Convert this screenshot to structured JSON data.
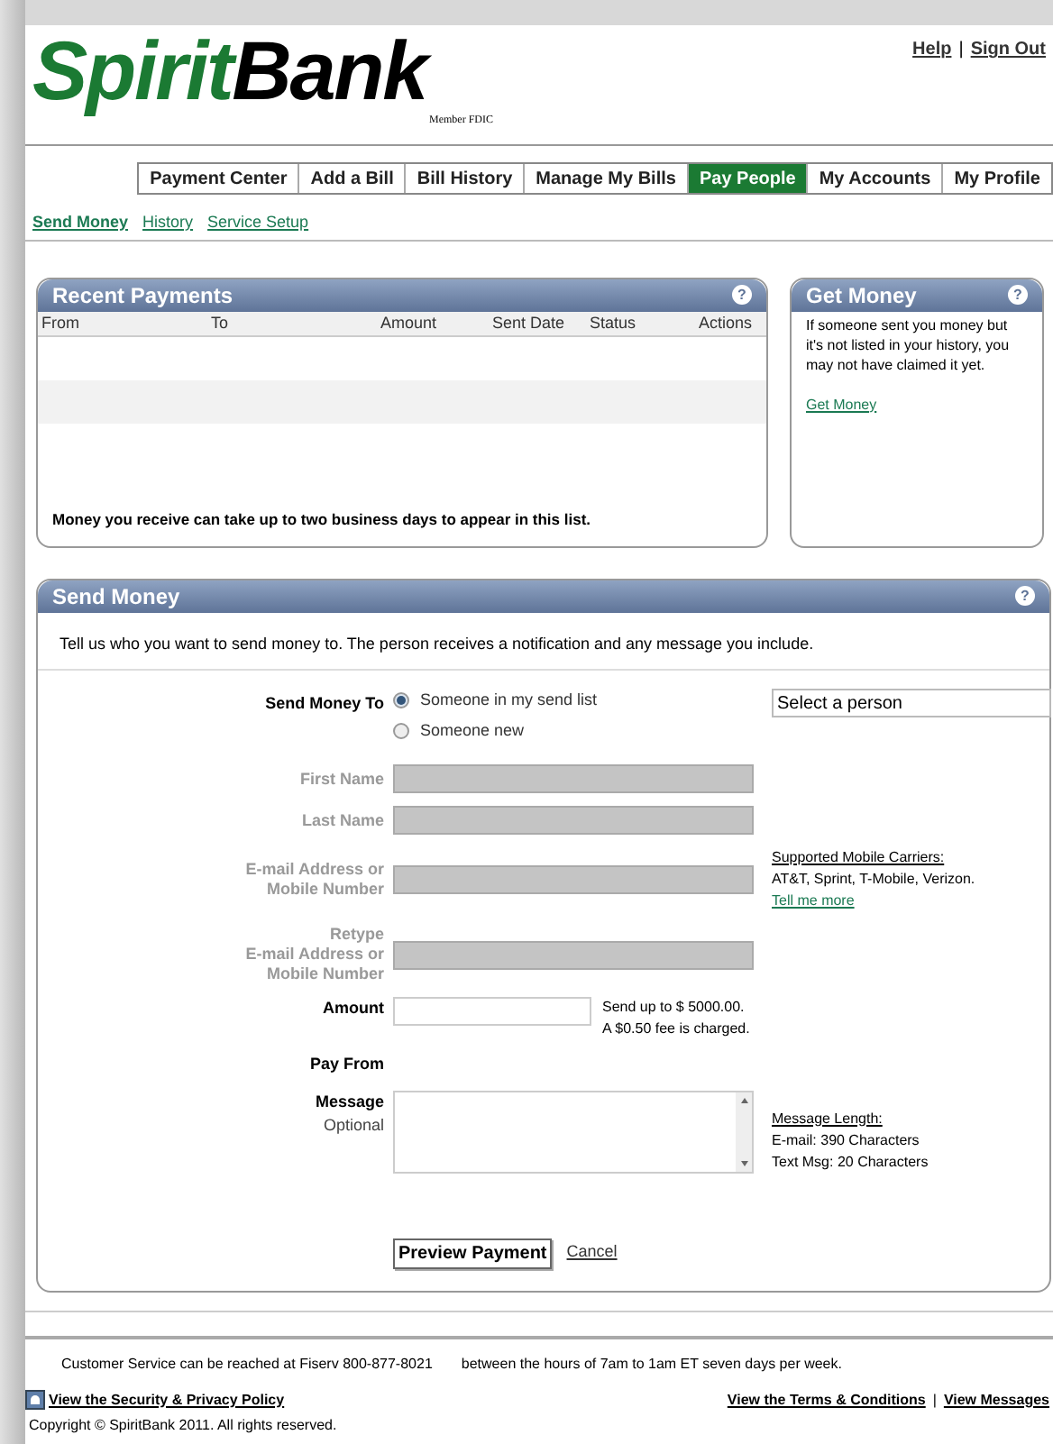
{
  "header": {
    "logo_green": "Spirit",
    "logo_black": "Bank",
    "logo_sub": "Member FDIC",
    "links": [
      "Help",
      "Sign Out"
    ],
    "separator": "|"
  },
  "nav_tabs": [
    {
      "label": "Payment Center",
      "selected": false
    },
    {
      "label": "Add a Bill",
      "selected": false
    },
    {
      "label": "Bill History",
      "selected": false
    },
    {
      "label": "Manage My Bills",
      "selected": false
    },
    {
      "label": "Pay People",
      "selected": true
    },
    {
      "label": "My Accounts",
      "selected": false
    },
    {
      "label": "My Profile",
      "selected": false
    }
  ],
  "subnav": [
    {
      "label": "Send Money",
      "selected": true
    },
    {
      "label": "History",
      "selected": false
    },
    {
      "label": "Service Setup",
      "selected": false
    }
  ],
  "recent_payments": {
    "title": "Recent Payments",
    "help": "?",
    "columns": [
      "From",
      "To",
      "Amount",
      "Sent Date",
      "Status",
      "Actions"
    ],
    "note": "Money you receive can take up to two business days to appear in this list."
  },
  "get_money": {
    "title": "Get Money",
    "help": "?",
    "text": "If someone sent you money but it's not listed in your history, you may not have claimed it yet.",
    "link": "Get Money"
  },
  "send_money": {
    "title": "Send Money",
    "help": "?",
    "intro": "Tell us who you want to send money to. The person receives a notification and any message you include.",
    "send_to": {
      "label": "Send Money To",
      "options": [
        {
          "label": "Someone in my send list",
          "selected": true
        },
        {
          "label": "Someone new",
          "selected": false
        }
      ],
      "select_value": "Select a person"
    },
    "fields": [
      {
        "label_lines": [
          "First Name"
        ],
        "disabled": true
      },
      {
        "label_lines": [
          "Last Name"
        ],
        "disabled": true
      },
      {
        "label_lines": [
          "E-mail Address or",
          "Mobile Number"
        ],
        "disabled": true,
        "note_title": "Supported Mobile Carriers:",
        "note_text": "AT&T, Sprint, T-Mobile, Verizon.",
        "note_link": "Tell me more"
      },
      {
        "label_lines": [
          "Retype",
          "E-mail Address or",
          "Mobile Number"
        ],
        "disabled": true
      }
    ],
    "amount": {
      "label": "Amount",
      "hint_lines": [
        "Send up to $ 5000.00.",
        "A $0.50 fee is charged."
      ]
    },
    "pay_from": {
      "label": "Pay From"
    },
    "message": {
      "label": "Message",
      "sublabel": "Optional",
      "hint_title": "Message Length:",
      "hint_lines": [
        "E-mail: 390 Characters",
        "Text Msg: 20 Characters"
      ]
    },
    "preview_button": "Preview Payment",
    "cancel_link": "Cancel"
  },
  "footer": {
    "service": "Customer Service can be reached at Fiserv 800-877-8021",
    "hours": "between the hours of 7am to 1am ET seven days per week.",
    "security_link": "View the Security & Privacy Policy",
    "links": [
      "View the Terms & Conditions",
      "View Messages"
    ],
    "separator": "|",
    "copyright": "Copyright © SpiritBank 2011. All rights reserved."
  }
}
